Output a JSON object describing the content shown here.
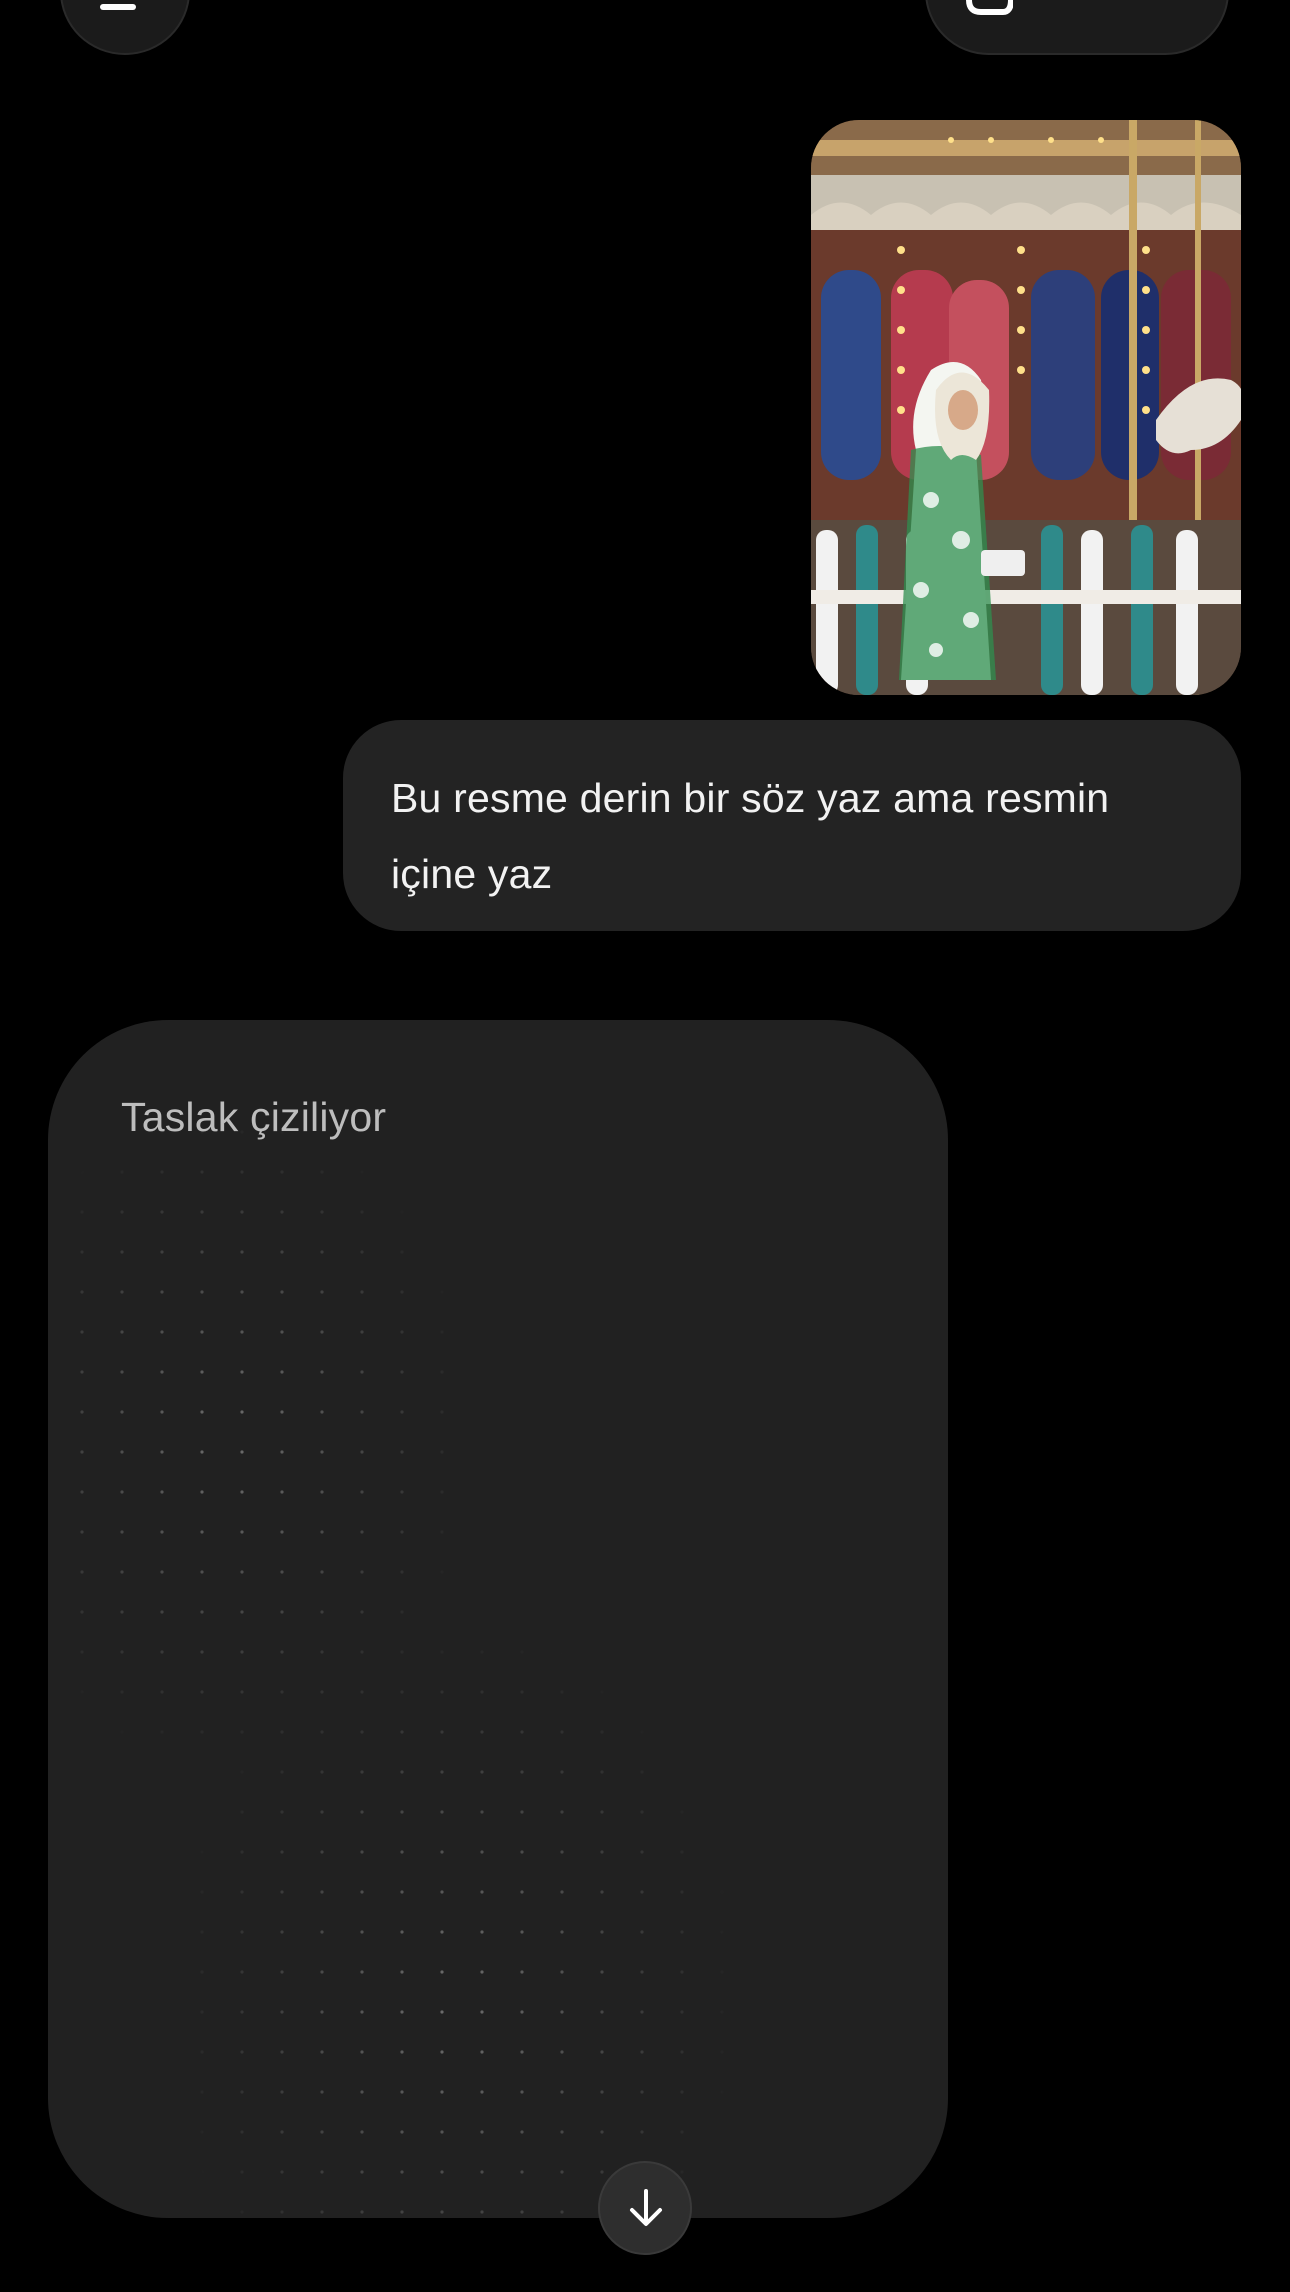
{
  "header": {
    "menu_icon": "menu-icon",
    "new_chat_icon": "new-chat-icon"
  },
  "conversation": {
    "user_image": {
      "icon": "photo-carousel-woman"
    },
    "user_message": "Bu resme derin bir söz yaz ama resmin içine yaz",
    "assistant_draft": {
      "status_text": "Taslak çiziliyor"
    }
  },
  "scroll_down_icon": "arrow-down-icon",
  "colors": {
    "background": "#000000",
    "bubble": "#232323",
    "card": "#212121",
    "status_text": "#bdbdbd"
  }
}
